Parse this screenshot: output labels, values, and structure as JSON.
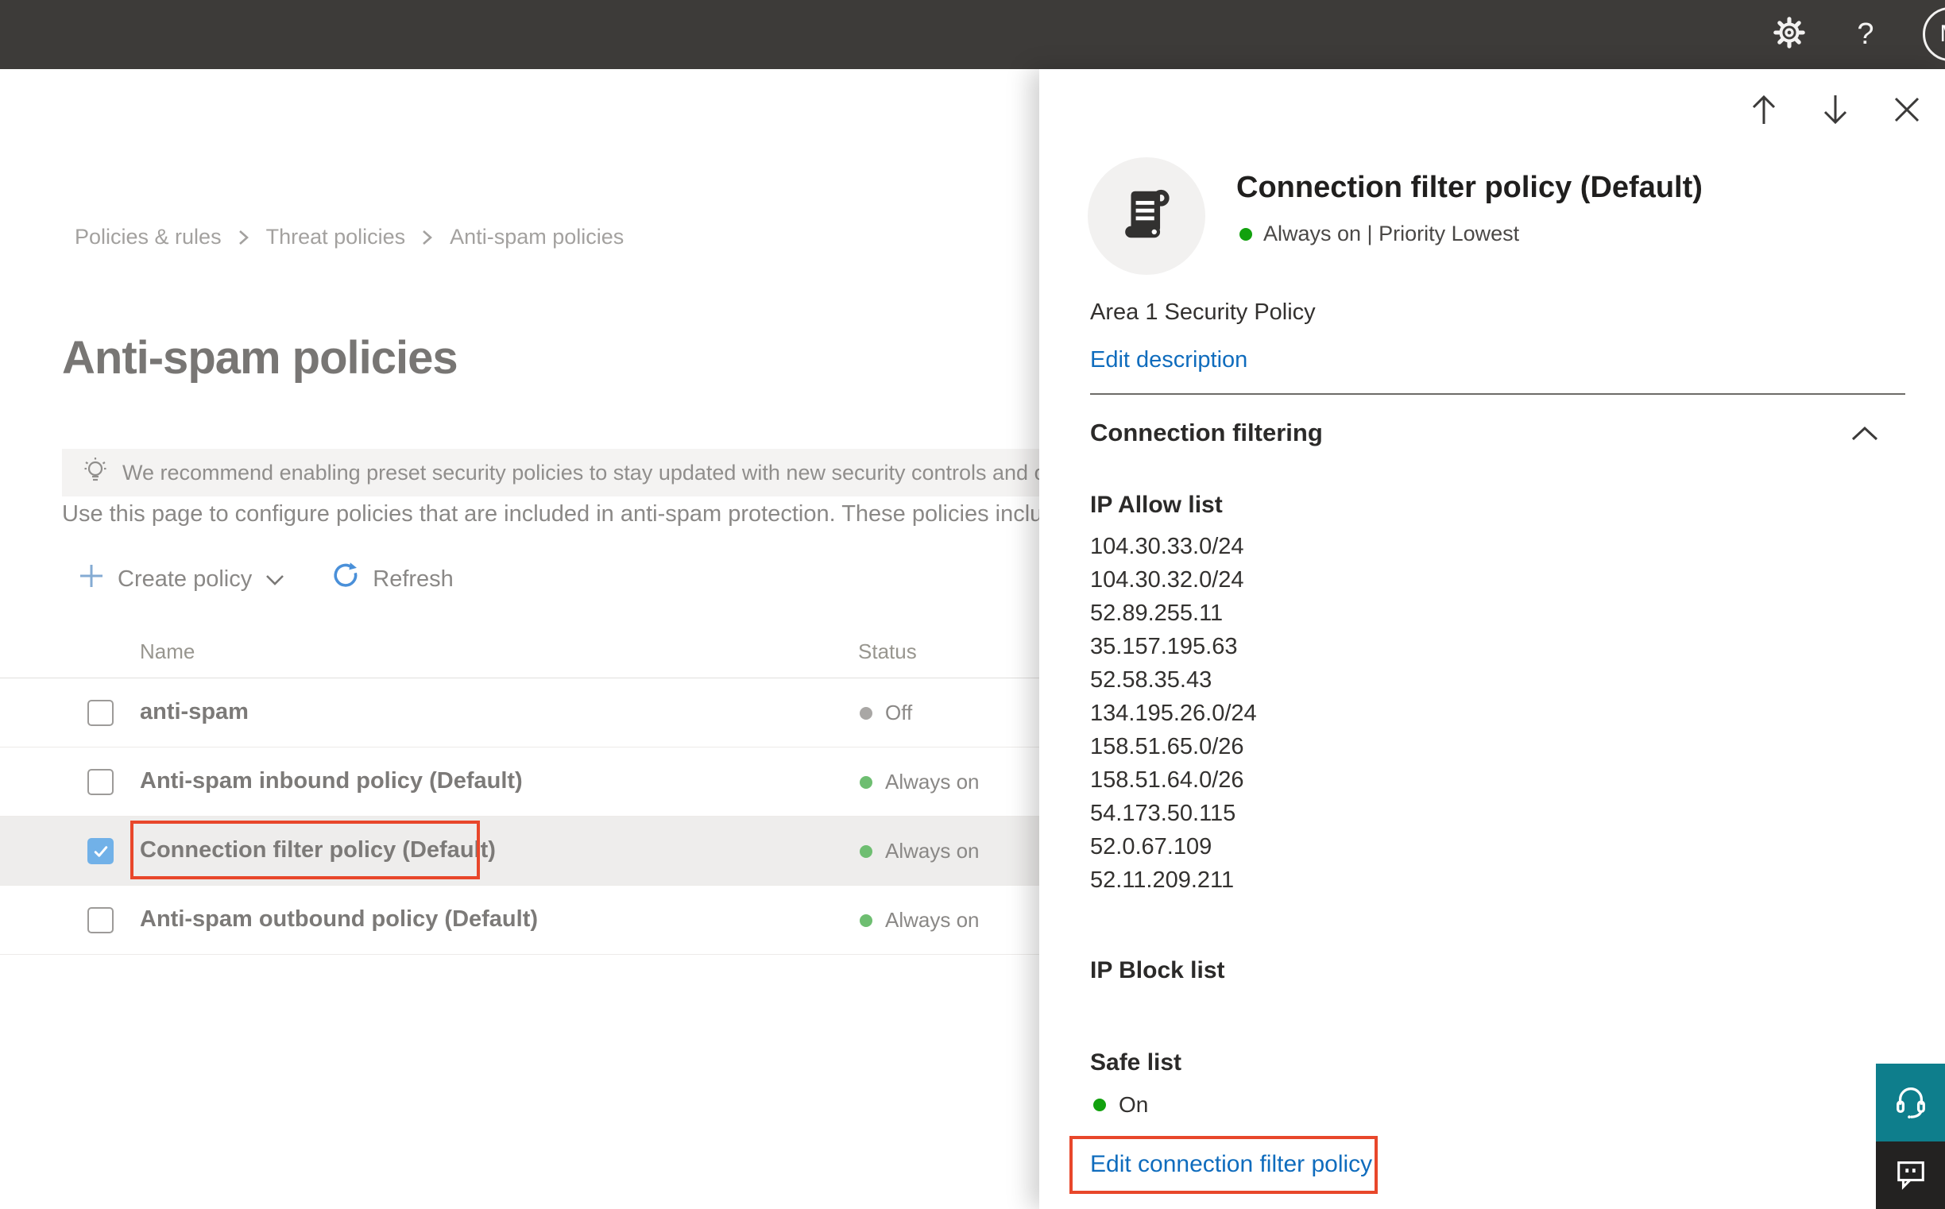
{
  "topbar": {
    "help_label": "?",
    "avatar_initial": "M"
  },
  "breadcrumb": {
    "items": [
      "Policies & rules",
      "Threat policies",
      "Anti-spam policies"
    ]
  },
  "page": {
    "title": "Anti-spam policies",
    "banner_text": "We recommend enabling preset security policies to stay updated with new security controls and our recomme",
    "intro_text": "Use this page to configure policies that are included in anti-spam protection. These policies include ",
    "toolbar": {
      "create_policy_label": "Create policy",
      "refresh_label": "Refresh"
    },
    "table": {
      "columns": {
        "name": "Name",
        "status": "Status"
      },
      "rows": [
        {
          "name": "anti-spam",
          "status": "Off",
          "status_color": "gray",
          "checked": false,
          "selected": false
        },
        {
          "name": "Anti-spam inbound policy (Default)",
          "status": "Always on",
          "status_color": "green",
          "checked": false,
          "selected": false
        },
        {
          "name": "Connection filter policy (Default)",
          "status": "Always on",
          "status_color": "green",
          "checked": true,
          "selected": true,
          "annotated": true
        },
        {
          "name": "Anti-spam outbound policy (Default)",
          "status": "Always on",
          "status_color": "green",
          "checked": false,
          "selected": false
        }
      ]
    }
  },
  "panel": {
    "title": "Connection filter policy (Default)",
    "status_line": "Always on | Priority Lowest",
    "description": "Area 1 Security Policy",
    "edit_description_label": "Edit description",
    "section_title": "Connection filtering",
    "ip_allow": {
      "title": "IP Allow list",
      "ips": [
        "104.30.33.0/24",
        "104.30.32.0/24",
        "52.89.255.11",
        "35.157.195.63",
        "52.58.35.43",
        "134.195.26.0/24",
        "158.51.65.0/26",
        "158.51.64.0/26",
        "54.173.50.115",
        "52.0.67.109",
        "52.11.209.211"
      ]
    },
    "ip_block": {
      "title": "IP Block list"
    },
    "safe_list": {
      "title": "Safe list",
      "status": "On"
    },
    "edit_link_label": "Edit connection filter policy"
  },
  "colors": {
    "topbar_bg": "#3d3b39",
    "accent_blue": "#0f6cbd",
    "annotation_red": "#e8472b",
    "status_green": "#6ebe71",
    "status_green_bright": "#12a10e",
    "status_gray": "#a9a7a5",
    "selected_row_bg": "#eeedec",
    "checkbox_checked": "#71b1e8",
    "help_teal": "#0e7e8c"
  }
}
